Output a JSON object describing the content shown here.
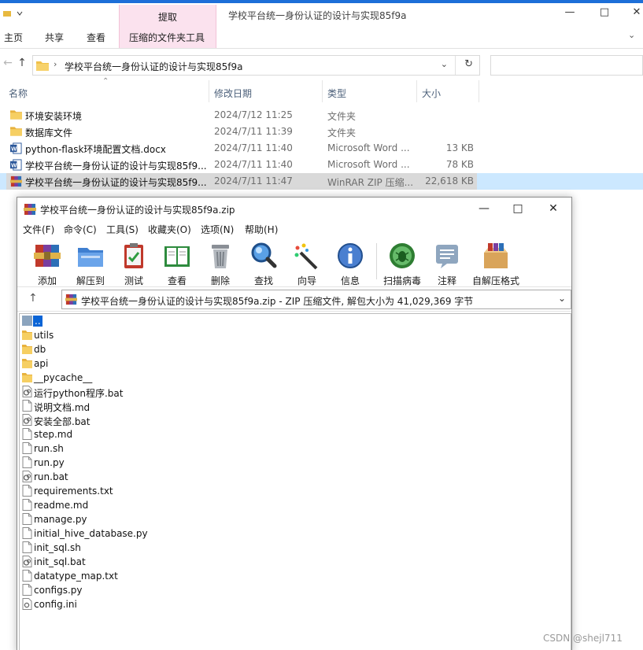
{
  "explorer": {
    "title": "学校平台统一身份认证的设计与实现85f9a",
    "context_tab": "提取",
    "ribbon_tabs": [
      "主页",
      "共享",
      "查看",
      "压缩的文件夹工具"
    ],
    "address_path": "学校平台统一身份认证的设计与实现85f9a",
    "columns": [
      "名称",
      "修改日期",
      "类型",
      "大小"
    ],
    "files": [
      {
        "icon": "folder-icon",
        "name": "环境安装环境",
        "date": "2024/7/12 11:25",
        "type": "文件夹",
        "size": ""
      },
      {
        "icon": "folder-icon",
        "name": "数据库文件",
        "date": "2024/7/11 11:39",
        "type": "文件夹",
        "size": ""
      },
      {
        "icon": "word-doc-icon",
        "name": "python-flask环境配置文档.docx",
        "date": "2024/7/11 11:40",
        "type": "Microsoft Word ...",
        "size": "13 KB"
      },
      {
        "icon": "word-doc-icon",
        "name": "学校平台统一身份认证的设计与实现85f9...",
        "date": "2024/7/11 11:40",
        "type": "Microsoft Word ...",
        "size": "78 KB"
      },
      {
        "icon": "winrar-archive-icon",
        "name": "学校平台统一身份认证的设计与实现85f9...",
        "date": "2024/7/11 11:47",
        "type": "WinRAR ZIP 压缩...",
        "size": "22,618 KB",
        "selected": true
      }
    ]
  },
  "winrar": {
    "title": "学校平台统一身份认证的设计与实现85f9a.zip",
    "menu": [
      "文件(F)",
      "命令(C)",
      "工具(S)",
      "收藏夹(O)",
      "选项(N)",
      "帮助(H)"
    ],
    "toolbar": [
      {
        "label": "添加",
        "icon": "add-archive-icon"
      },
      {
        "label": "解压到",
        "icon": "extract-to-icon"
      },
      {
        "label": "测试",
        "icon": "test-icon"
      },
      {
        "label": "查看",
        "icon": "view-book-icon"
      },
      {
        "label": "删除",
        "icon": "trash-icon"
      },
      {
        "label": "查找",
        "icon": "magnifier-icon"
      },
      {
        "label": "向导",
        "icon": "wizard-wand-icon"
      },
      {
        "label": "信息",
        "icon": "info-icon"
      },
      {
        "label": "扫描病毒",
        "icon": "virus-scan-icon"
      },
      {
        "label": "注释",
        "icon": "comment-icon"
      },
      {
        "label": "自解压格式",
        "icon": "sfx-box-icon"
      }
    ],
    "address_text": "学校平台统一身份认证的设计与实现85f9a.zip - ZIP 压缩文件, 解包大小为 41,029,369 字节",
    "entries": [
      {
        "name": "..",
        "kind": "up"
      },
      {
        "name": "utils",
        "kind": "folder"
      },
      {
        "name": "db",
        "kind": "folder"
      },
      {
        "name": "api",
        "kind": "folder"
      },
      {
        "name": "__pycache__",
        "kind": "folder"
      },
      {
        "name": "运行python程序.bat",
        "kind": "bat"
      },
      {
        "name": "说明文档.md",
        "kind": "file"
      },
      {
        "name": "安装全部.bat",
        "kind": "bat"
      },
      {
        "name": "step.md",
        "kind": "file"
      },
      {
        "name": "run.sh",
        "kind": "file"
      },
      {
        "name": "run.py",
        "kind": "file"
      },
      {
        "name": "run.bat",
        "kind": "bat"
      },
      {
        "name": "requirements.txt",
        "kind": "file"
      },
      {
        "name": "readme.md",
        "kind": "file"
      },
      {
        "name": "manage.py",
        "kind": "file"
      },
      {
        "name": "initial_hive_database.py",
        "kind": "file"
      },
      {
        "name": "init_sql.sh",
        "kind": "file"
      },
      {
        "name": "init_sql.bat",
        "kind": "bat"
      },
      {
        "name": "datatype_map.txt",
        "kind": "file"
      },
      {
        "name": "configs.py",
        "kind": "file"
      },
      {
        "name": "config.ini",
        "kind": "ini"
      }
    ]
  },
  "watermark": "CSDN @shejl711"
}
